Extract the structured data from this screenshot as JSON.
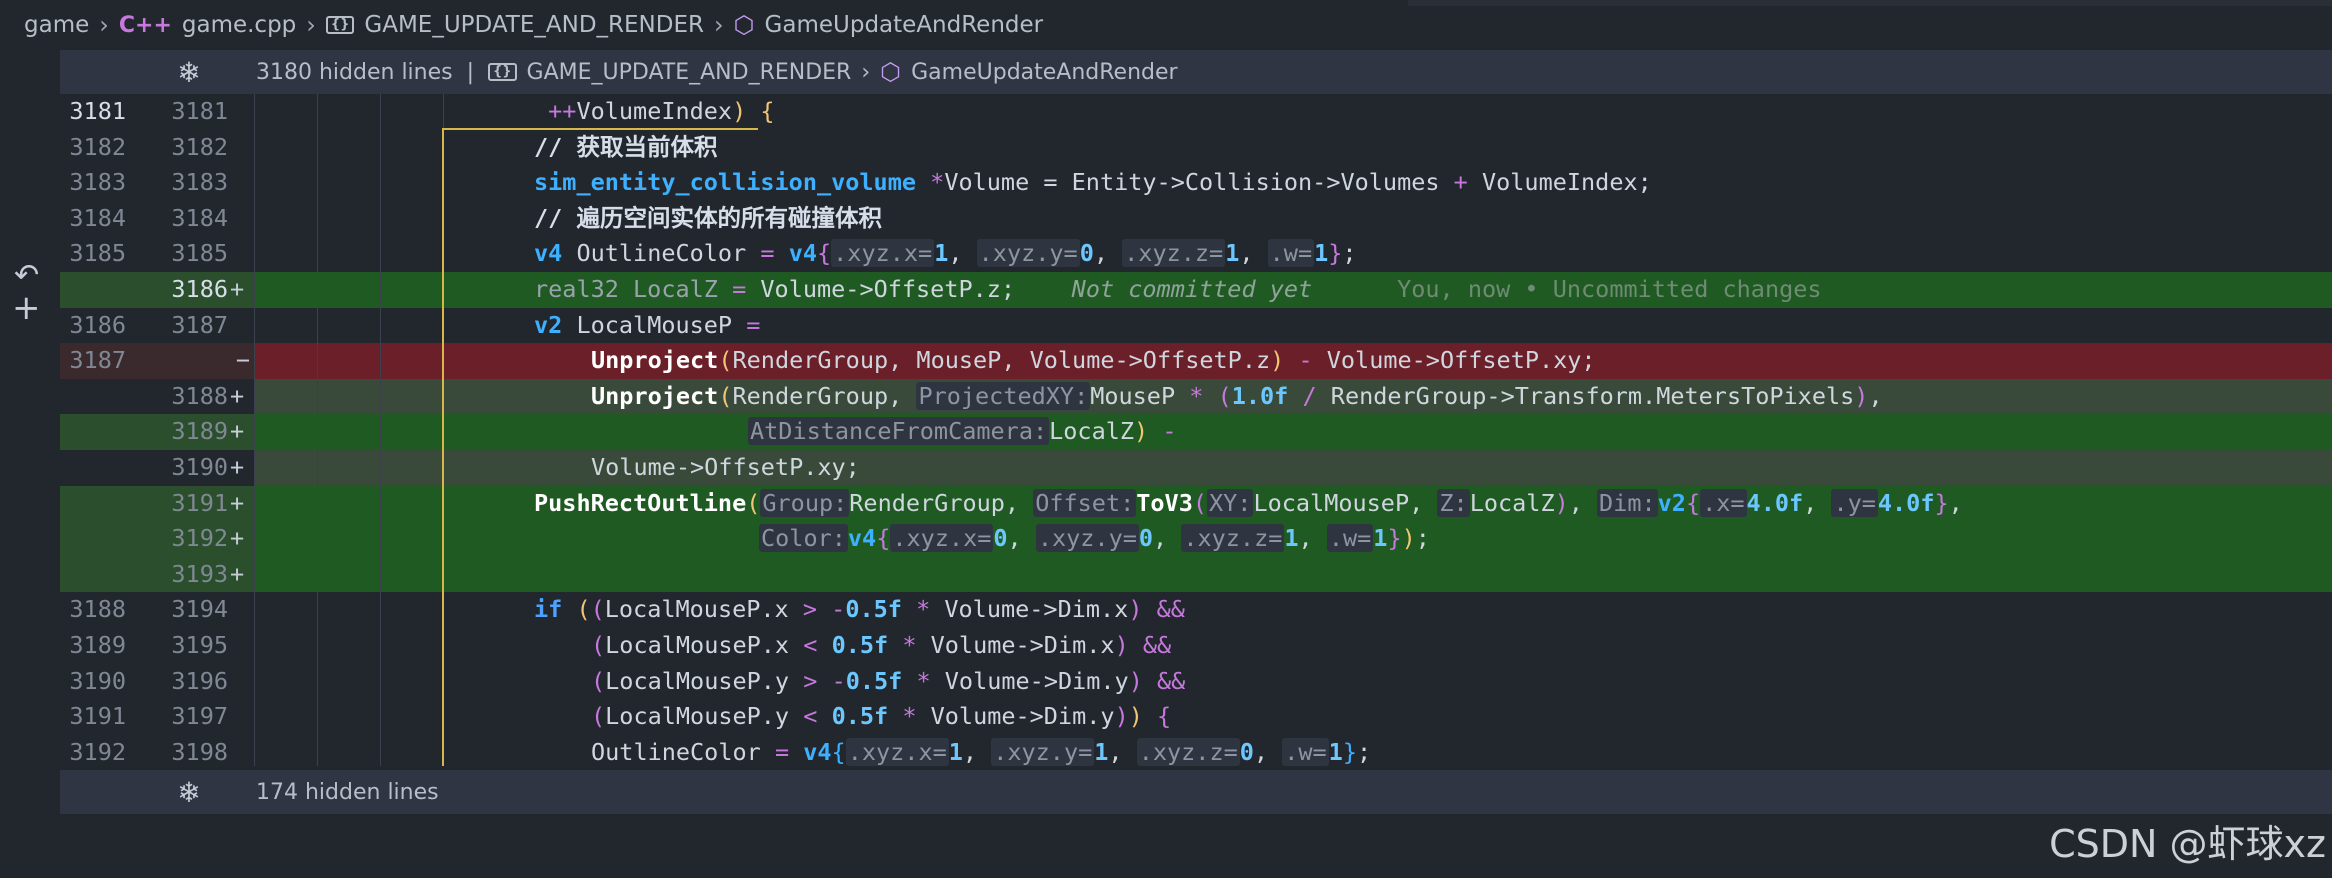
{
  "breadcrumb": {
    "folder": "game",
    "file_icon": "C++",
    "file": "game.cpp",
    "namespace": "GAME_UPDATE_AND_RENDER",
    "function": "GameUpdateAndRender"
  },
  "hidden_top": {
    "label": "3180 hidden lines",
    "pipe": "|",
    "namespace": "GAME_UPDATE_AND_RENDER",
    "function": "GameUpdateAndRender"
  },
  "hidden_bottom": {
    "label": "174 hidden lines"
  },
  "lines": [
    {
      "old": "3181",
      "new": "3181",
      "mark": ""
    },
    {
      "old": "3182",
      "new": "3182",
      "mark": ""
    },
    {
      "old": "3183",
      "new": "3183",
      "mark": ""
    },
    {
      "old": "3184",
      "new": "3184",
      "mark": ""
    },
    {
      "old": "3185",
      "new": "3185",
      "mark": ""
    },
    {
      "old": "",
      "new": "3186",
      "mark": "+"
    },
    {
      "old": "3186",
      "new": "3187",
      "mark": ""
    },
    {
      "old": "3187",
      "new": "",
      "mark": "−"
    },
    {
      "old": "",
      "new": "3188",
      "mark": "+"
    },
    {
      "old": "",
      "new": "3189",
      "mark": "+"
    },
    {
      "old": "",
      "new": "3190",
      "mark": "+"
    },
    {
      "old": "",
      "new": "3191",
      "mark": "+"
    },
    {
      "old": "",
      "new": "3192",
      "mark": "+"
    },
    {
      "old": "",
      "new": "3193",
      "mark": "+"
    },
    {
      "old": "3188",
      "new": "3194",
      "mark": ""
    },
    {
      "old": "3189",
      "new": "3195",
      "mark": ""
    },
    {
      "old": "3190",
      "new": "3196",
      "mark": ""
    },
    {
      "old": "3191",
      "new": "3197",
      "mark": ""
    },
    {
      "old": "3192",
      "new": "3198",
      "mark": ""
    }
  ],
  "code": {
    "l1_index": "VolumeIndex",
    "l2_comment": "// 获取当前体积",
    "l3_type": "sim_entity_collision_volume",
    "l3_rest": "Volume = Entity->Collision->Volumes",
    "l3_idx": "VolumeIndex;",
    "l4_comment": "// 遍历空间实体的所有碰撞体积",
    "l5_type": "v4",
    "l5_var": "OutlineColor",
    "l6_code": "real32 LocalZ",
    "l6_rhs": "Volume->OffsetP.z;",
    "l6_ghost": "Not committed yet",
    "l6_blame": "You, now • Uncommitted changes",
    "l7_type": "v2",
    "l7_var": "LocalMouseP",
    "fn_unproject": "Unproject",
    "l8_args": "RenderGroup, MouseP, Volume->OffsetP.z",
    "l8_rest": "Volume->OffsetP.xy;",
    "l9_a": "RenderGroup,",
    "hint_projected": "ProjectedXY:",
    "l9_b": "MouseP",
    "l9_num": "1.0f",
    "l9_c": "RenderGroup->Transform.MetersToPixels",
    "hint_distance": "AtDistanceFromCamera:",
    "l10_var": "LocalZ",
    "l11_code": "Volume->OffsetP.xy;",
    "fn_push": "PushRectOutline",
    "hint_group": "Group:",
    "l12_group": "RenderGroup,",
    "hint_offset": "Offset:",
    "fn_tov3": "ToV3",
    "hint_xy": "XY:",
    "l12_xy": "LocalMouseP,",
    "hint_z": "Z:",
    "l12_z": "LocalZ",
    "hint_dim": "Dim:",
    "hint_color": "Color:",
    "l15_a": "LocalMouseP.x",
    "l15_b": "Volume->Dim.x",
    "l16_a": "LocalMouseP.x",
    "l16_b": "Volume->Dim.x",
    "l17_a": "LocalMouseP.y",
    "l17_b": "Volume->Dim.y",
    "l18_a": "LocalMouseP.y",
    "l18_b": "Volume->Dim.y",
    "l19_var": "OutlineColor"
  },
  "watermark": "CSDN @虾球xz"
}
